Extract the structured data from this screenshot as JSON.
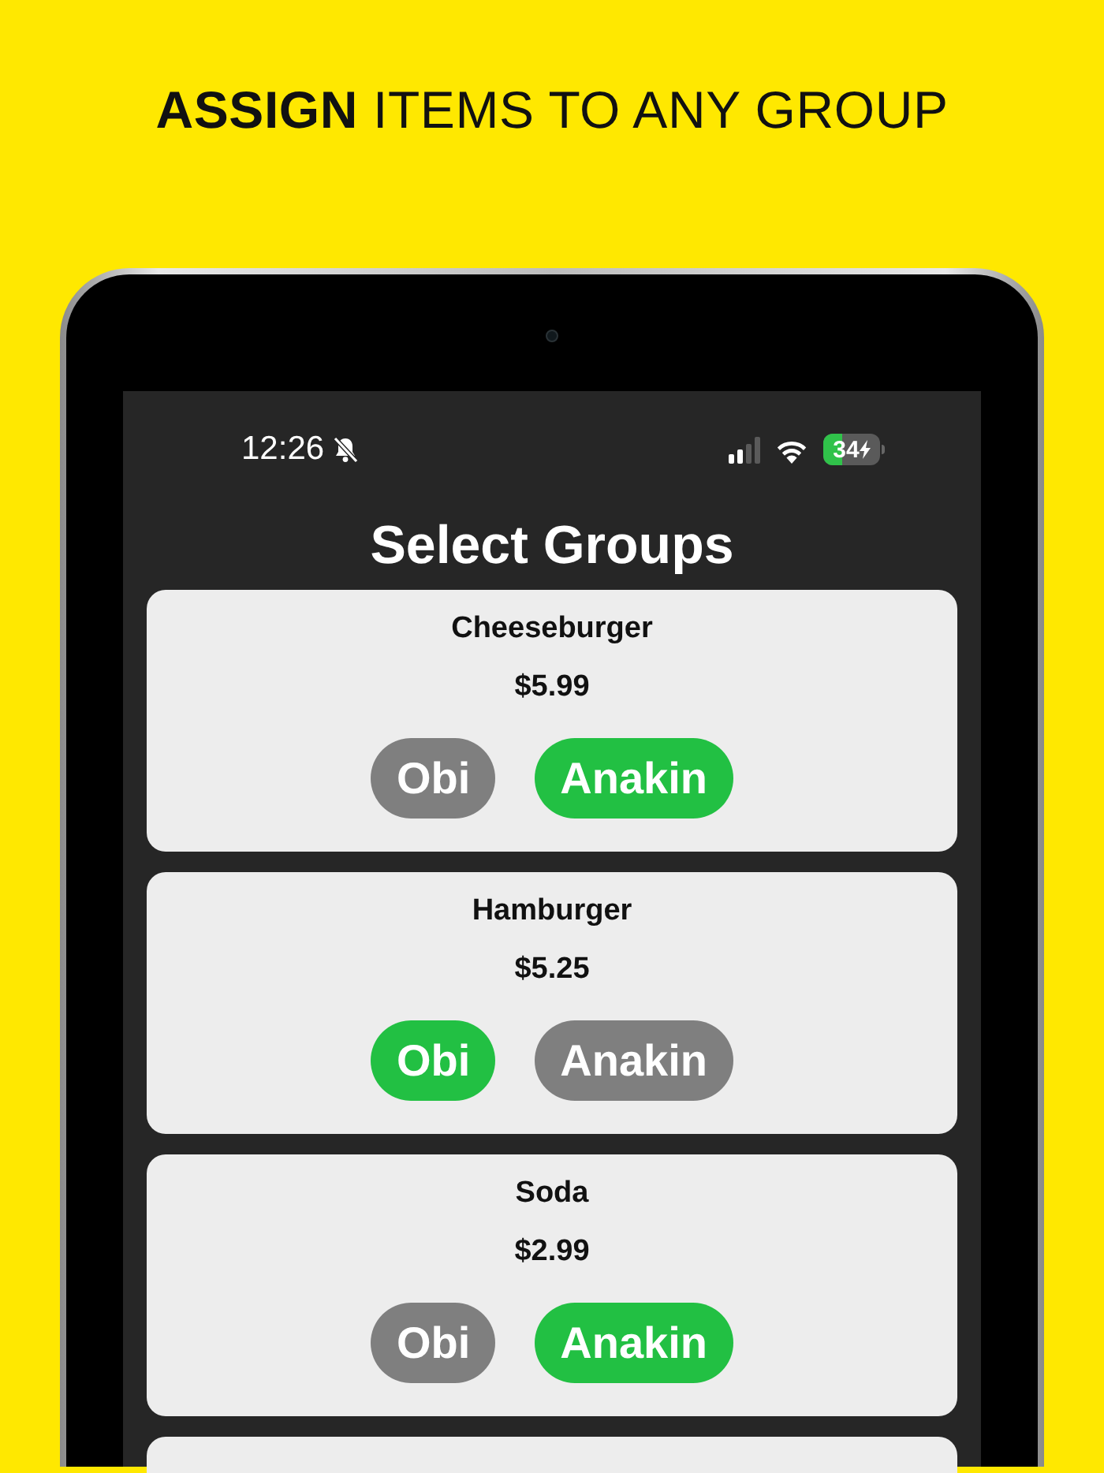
{
  "headline": "**ASSIGN** ITEMS TO ANY GROUP",
  "status_bar": {
    "time": "12:26",
    "battery": "34"
  },
  "title": "Select Groups",
  "items": [
    {
      "name": "Cheeseburger",
      "price": "$5.99",
      "groups": [
        {
          "label": "Obi",
          "selected": false
        },
        {
          "label": "Anakin",
          "selected": true
        }
      ]
    },
    {
      "name": "Hamburger",
      "price": "$5.25",
      "groups": [
        {
          "label": "Obi",
          "selected": true
        },
        {
          "label": "Anakin",
          "selected": false
        }
      ]
    },
    {
      "name": "Soda",
      "price": "$2.99",
      "groups": [
        {
          "label": "Obi",
          "selected": false
        },
        {
          "label": "Anakin",
          "selected": true
        }
      ]
    }
  ]
}
